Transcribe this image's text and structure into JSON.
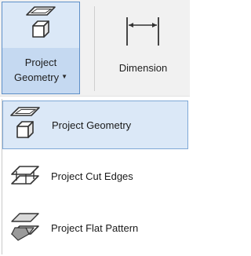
{
  "ribbon": {
    "project_geometry_button": {
      "label_line1": "Project",
      "label_line2": "Geometry",
      "icon": "project-geometry-icon",
      "has_dropdown": true
    },
    "dimension_button": {
      "label": "Dimension",
      "icon": "dimension-icon"
    }
  },
  "menu": {
    "items": [
      {
        "label": "Project Geometry",
        "icon": "project-geometry-icon",
        "selected": true
      },
      {
        "label": "Project Cut Edges",
        "icon": "project-cut-edges-icon",
        "selected": false
      },
      {
        "label": "Project Flat Pattern",
        "icon": "project-flat-pattern-icon",
        "selected": false
      }
    ]
  },
  "colors": {
    "highlight_fill": "#dbe8f7",
    "highlight_border": "#7fa8d6",
    "ribbon_bg": "#f1f1f1"
  }
}
